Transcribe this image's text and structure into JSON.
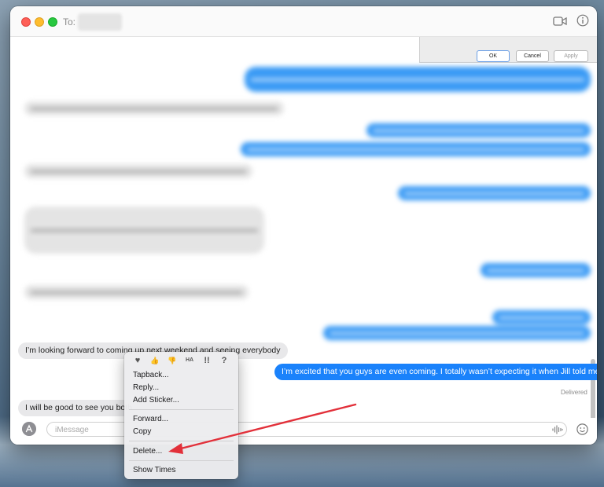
{
  "window": {
    "to_label": "To:",
    "icons": {
      "video": "video-camera-icon",
      "info": "info-icon"
    }
  },
  "background_dialog": {
    "ok_label": "OK",
    "cancel_label": "Cancel",
    "apply_label": "Apply"
  },
  "messages": [
    {
      "direction": "incoming",
      "text": "I’m looking forward to coming up next weekend and seeing everybody"
    },
    {
      "direction": "outgoing",
      "text": "I’m excited that you guys are even coming. I totally wasn’t expecting it when Jill told me"
    },
    {
      "direction": "incoming",
      "text": "I will be good to see you both"
    }
  ],
  "status": {
    "delivered": "Delivered"
  },
  "composer": {
    "placeholder": "iMessage",
    "icons": {
      "apps": "app-store-icon",
      "audio": "audio-waveform-icon",
      "emoji": "emoji-smiley-icon"
    }
  },
  "context_menu": {
    "tapbacks": [
      "heart-icon",
      "thumbs-up-icon",
      "thumbs-down-icon",
      "haha-icon",
      "exclamation-icon",
      "question-icon"
    ],
    "tapback_glyphs": [
      "♥",
      "👍",
      "👎",
      "HA",
      "!!",
      "?"
    ],
    "items": {
      "tapback": "Tapback...",
      "reply": "Reply...",
      "add_sticker": "Add Sticker...",
      "forward": "Forward...",
      "copy": "Copy",
      "delete": "Delete...",
      "show_times": "Show Times"
    }
  },
  "colors": {
    "outgoing_bubble": "#1a82fb",
    "incoming_bubble": "#e8e8ea",
    "annotation_arrow": "#e2303a"
  }
}
